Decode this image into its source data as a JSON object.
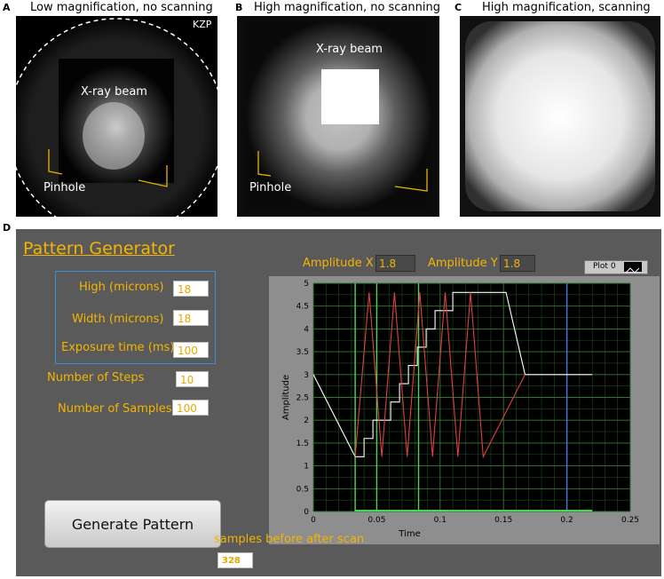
{
  "panels": {
    "a": {
      "letter": "A",
      "title": "Low magnification, no scanning",
      "beam_label": "X-ray beam",
      "pinhole_label": "Pinhole",
      "kzp_label": "KZP"
    },
    "b": {
      "letter": "B",
      "title": "High magnification, no scanning",
      "beam_label": "X-ray beam",
      "pinhole_label": "Pinhole"
    },
    "c": {
      "letter": "C",
      "title": "High magnification, scanning"
    },
    "d": {
      "letter": "D"
    }
  },
  "pattern_generator": {
    "title": "Pattern Generator",
    "fields": [
      {
        "label": "High (microns)",
        "value": "18"
      },
      {
        "label": "Width (microns)",
        "value": "18"
      },
      {
        "label": "Exposure time (ms)",
        "value": "100"
      },
      {
        "label": "Number of Steps",
        "value": "10"
      },
      {
        "label": "Number of Samples",
        "value": "100"
      }
    ],
    "amplitude_x_label": "Amplitude X",
    "amplitude_x": "1.8",
    "amplitude_y_label": "Amplitude Y",
    "amplitude_y": "1.8",
    "plot_legend": "Plot 0",
    "generate_button": "Generate Pattern",
    "samples_label": "samples before after scan",
    "samples_value": "328"
  },
  "chart_data": {
    "type": "line",
    "xlabel": "Time",
    "ylabel": "Amplitude",
    "xlim": [
      0,
      0.25
    ],
    "ylim": [
      0,
      5
    ],
    "x_ticks": [
      "0",
      "0.05",
      "0.1",
      "0.15",
      "0.2",
      "0.25"
    ],
    "y_ticks": [
      "0",
      "0.5",
      "1",
      "1.5",
      "2",
      "2.5",
      "3",
      "3.5",
      "4",
      "4.5",
      "5"
    ],
    "grid": true,
    "cursors_x": [
      0.033,
      0.05,
      0.083
    ],
    "cursor_blue_x": 0.2,
    "series": [
      {
        "color": "#ffffff",
        "x": [
          0,
          0.033,
          0.033,
          0.04,
          0.04,
          0.047,
          0.047,
          0.054,
          0.054,
          0.061,
          0.061,
          0.068,
          0.068,
          0.075,
          0.075,
          0.082,
          0.082,
          0.089,
          0.089,
          0.096,
          0.096,
          0.103,
          0.103,
          0.11,
          0.11,
          0.117,
          0.117,
          0.124,
          0.124,
          0.131,
          0.131,
          0.138,
          0.138,
          0.145,
          0.145,
          0.152,
          0.167,
          0.22
        ],
        "y": [
          3,
          1.2,
          1.2,
          1.2,
          1.6,
          1.6,
          2.0,
          2.0,
          2.0,
          2.0,
          2.4,
          2.4,
          2.8,
          2.8,
          3.2,
          3.2,
          3.6,
          3.6,
          4.0,
          4.0,
          4.4,
          4.4,
          4.4,
          4.4,
          4.8,
          4.8,
          4.8,
          4.8,
          4.8,
          4.8,
          4.8,
          4.8,
          4.8,
          4.8,
          4.8,
          4.8,
          3,
          3
        ]
      },
      {
        "color": "#e04040",
        "x": [
          0.033,
          0.044,
          0.054,
          0.064,
          0.074,
          0.084,
          0.094,
          0.104,
          0.114,
          0.124,
          0.134,
          0.167
        ],
        "y": [
          1.2,
          4.8,
          1.2,
          4.8,
          1.2,
          4.8,
          1.2,
          4.8,
          1.2,
          4.8,
          1.2,
          3
        ]
      }
    ]
  }
}
